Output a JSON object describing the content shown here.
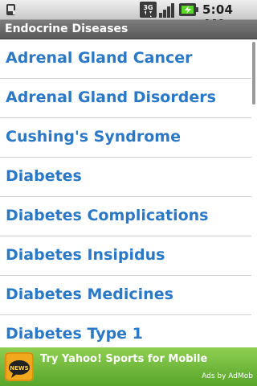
{
  "status_bar": {
    "time": "5:04 AM",
    "network_label": "3G",
    "icons": [
      "notification-icon",
      "network-3g-icon",
      "signal-strength-icon",
      "battery-charging-icon"
    ]
  },
  "title_bar": {
    "title": "Endocrine Diseases"
  },
  "list": {
    "items": [
      {
        "label": "Adrenal Gland Cancer"
      },
      {
        "label": "Adrenal Gland Disorders"
      },
      {
        "label": "Cushing's Syndrome"
      },
      {
        "label": "Diabetes"
      },
      {
        "label": "Diabetes Complications"
      },
      {
        "label": "Diabetes Insipidus"
      },
      {
        "label": "Diabetes Medicines"
      },
      {
        "label": "Diabetes Type 1"
      }
    ],
    "link_color": "#2a78c6"
  },
  "ad": {
    "icon_label": "NEWS",
    "text": "Try Yahoo! Sports for Mobile",
    "attribution": "Ads by AdMob",
    "background_color": "#6fbb3a"
  }
}
